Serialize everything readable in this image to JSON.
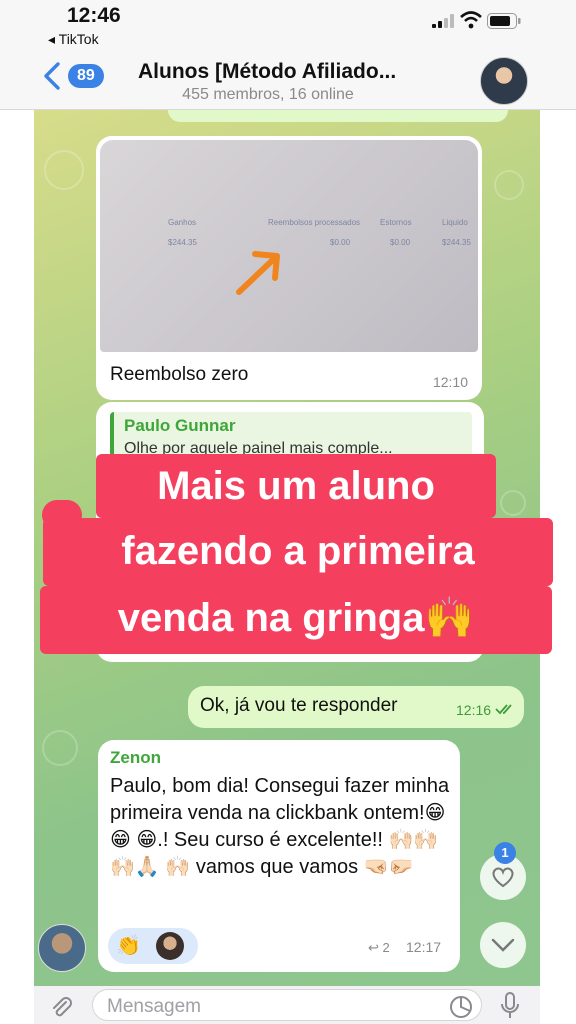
{
  "status_bar": {
    "time": "12:46",
    "back_app": "◂ TikTok"
  },
  "header": {
    "back_count": "89",
    "title": "Alunos [Método Afiliado...",
    "subtitle": "455 membros, 16 online"
  },
  "messages": {
    "photo": {
      "caption": "Reembolso zero",
      "time": "12:10"
    },
    "reply": {
      "quote_name": "Paulo Gunnar",
      "quote_text": "Olhe por aquele painel mais comple..."
    },
    "ok": {
      "text": "Ok, já vou te responder",
      "time": "12:16"
    },
    "zenon": {
      "name": "Zenon",
      "text": "Paulo, bom dia! Consegui fazer minha primeira venda na clickbank ontem!😁 😁 😁.! Seu curso é excelente!! 🙌🏻🙌🏻🙌🏻🙏🏻 🙌🏻 vamos que vamos 🤜🏻🤛🏻",
      "reaction_emoji": "👏",
      "forward_count": "↩ 2",
      "time": "12:17"
    }
  },
  "banner": {
    "line1": "Mais um aluno",
    "line2": "fazendo a primeira",
    "line3": "venda na gringa🙌"
  },
  "like_count": "1",
  "input": {
    "placeholder": "Mensagem"
  },
  "colors": {
    "accent": "#3b82e6",
    "banner": "#f43f5e",
    "sender_name": "#3fa63a",
    "outgoing": "#e1f9c8"
  }
}
